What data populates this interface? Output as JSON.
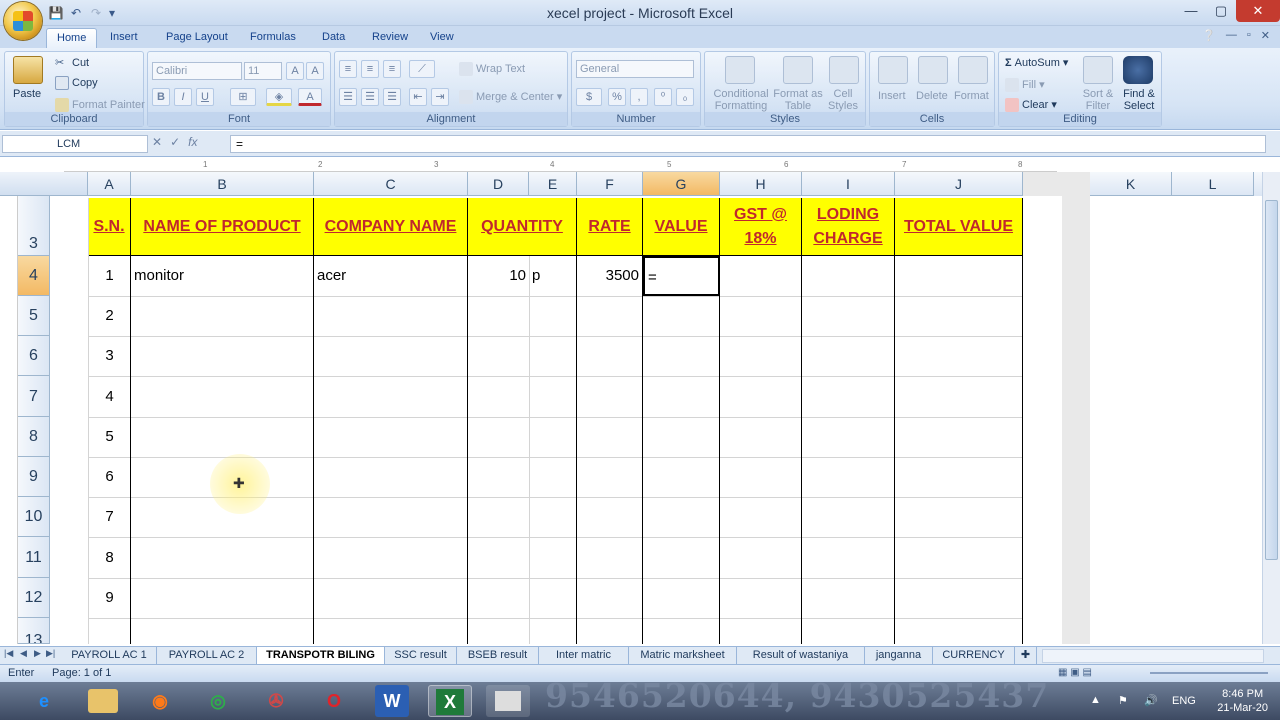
{
  "window": {
    "title": "xecel project - Microsoft Excel",
    "min": "—",
    "max": "▢",
    "close": "✕"
  },
  "ribbon_tabs": [
    "Home",
    "Insert",
    "Page Layout",
    "Formulas",
    "Data",
    "Review",
    "View"
  ],
  "ribbon": {
    "clipboard": {
      "paste": "Paste",
      "cut": "Cut",
      "copy": "Copy",
      "format_painter": "Format Painter",
      "label": "Clipboard"
    },
    "font": {
      "name": "Calibri",
      "size": "11",
      "label": "Font",
      "bold": "B",
      "italic": "I",
      "underline": "U"
    },
    "alignment": {
      "wrap": "Wrap Text",
      "merge": "Merge & Center",
      "label": "Alignment"
    },
    "number": {
      "format": "General",
      "currency": "$",
      "percent": "%",
      "comma": ",",
      "label": "Number"
    },
    "styles": {
      "conditional": "Conditional Formatting",
      "table": "Format as Table",
      "cell": "Cell Styles",
      "label": "Styles"
    },
    "cells": {
      "insert": "Insert",
      "delete": "Delete",
      "format": "Format",
      "label": "Cells"
    },
    "editing": {
      "autosum": "AutoSum",
      "fill": "Fill",
      "clear": "Clear",
      "sort": "Sort & Filter",
      "find": "Find & Select",
      "label": "Editing"
    }
  },
  "formula_bar": {
    "name_box": "LCM",
    "content": "=",
    "fx": "fx"
  },
  "columns": [
    "A",
    "B",
    "C",
    "D",
    "E",
    "F",
    "G",
    "H",
    "I",
    "J",
    "K",
    "L"
  ],
  "rows": [
    "3",
    "4",
    "5",
    "6",
    "7",
    "8",
    "9",
    "10",
    "11",
    "12",
    "13"
  ],
  "ruler_marks": [
    "1",
    "2",
    "3",
    "4",
    "5",
    "6",
    "7",
    "8"
  ],
  "headers": {
    "sn": "S.N.",
    "product": "NAME OF PRODUCT",
    "company": "COMPANY NAME",
    "quantity": "QUANTITY",
    "rate": "RATE",
    "value": "VALUE",
    "gst_line1": "GST @",
    "gst_line2": "18%",
    "loading_line1": "LODING",
    "loading_line2": "CHARGE",
    "total": "TOTAL VALUE"
  },
  "data_row": {
    "sn": "1",
    "product": "monitor",
    "company": "acer",
    "quantity": "10",
    "unit": "p",
    "rate": "3500",
    "value": "="
  },
  "serials": [
    "2",
    "3",
    "4",
    "5",
    "6",
    "7",
    "8",
    "9"
  ],
  "sheet_tabs": [
    "PAYROLL AC 1",
    "PAYROLL AC 2",
    "TRANSPOTR BILING",
    "SSC result",
    "BSEB result",
    "Inter matric",
    "Matric marksheet",
    "Result of wastaniya",
    "janganna",
    "CURRENCY"
  ],
  "active_sheet": "TRANSPOTR BILING",
  "status": {
    "mode": "Enter",
    "page": "Page: 1 of 1"
  },
  "taskbar": {
    "watermark": "9546520644, 9430525437",
    "lang": "ENG",
    "time": "8:46 PM",
    "date": "21-Mar-20"
  }
}
